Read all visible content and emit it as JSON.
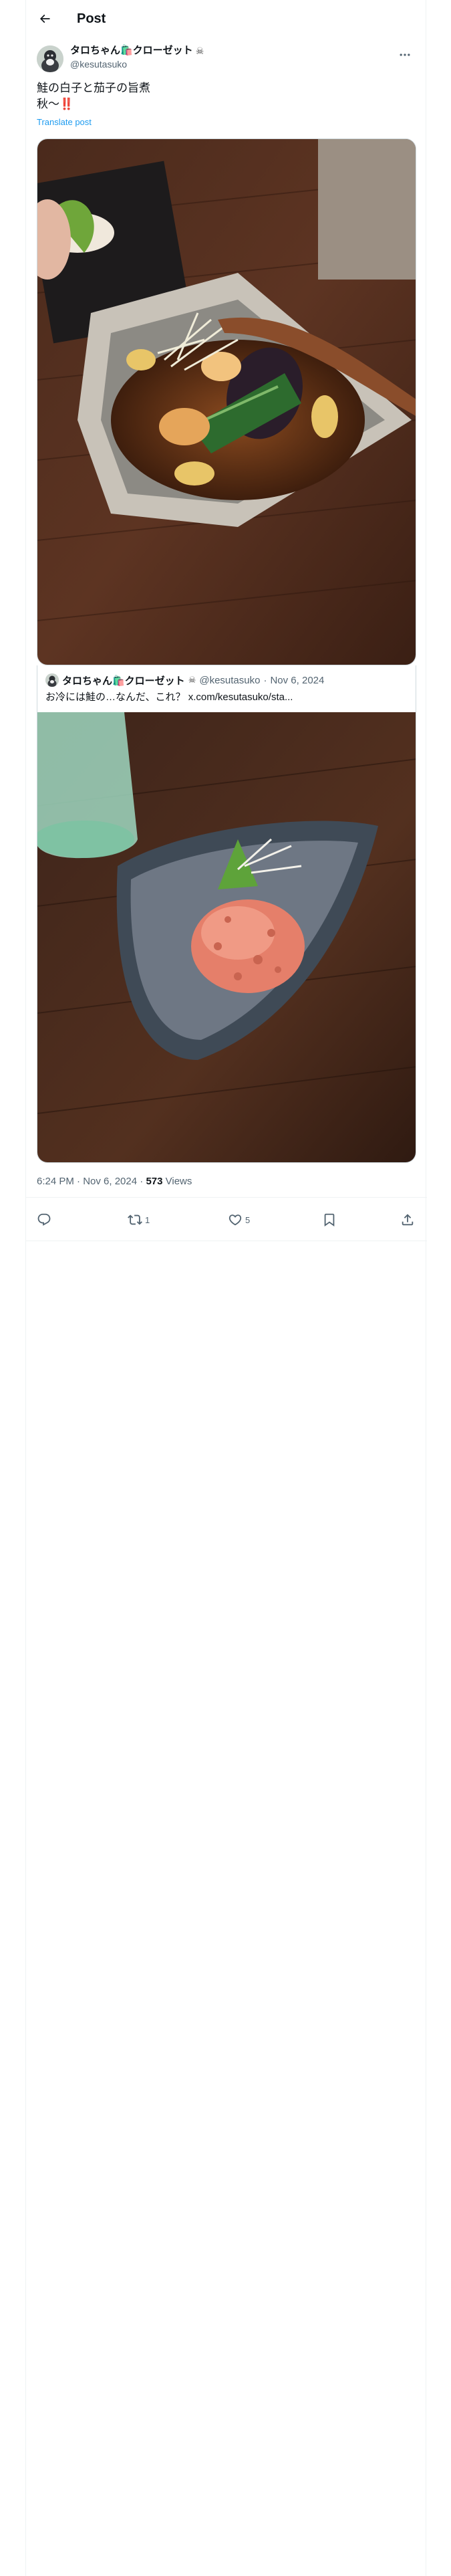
{
  "header": {
    "title": "Post"
  },
  "author": {
    "display_name": "タロちゃん🛍️クローゼット",
    "badge_icon": "skull-crossbones-icon",
    "handle": "@kesutasuko"
  },
  "tweet": {
    "text": "鮭の白子と茄子の旨煮\n秋〜‼️",
    "translate_label": "Translate post"
  },
  "quote": {
    "display_name": "タロちゃん🛍️クローゼット",
    "handle": "@kesutasuko",
    "separator": "·",
    "date": "Nov 6, 2024",
    "text": "お冷には鮭の…なんだ、これ？ x.com/kesutasuko/sta..."
  },
  "meta": {
    "time": "6:24 PM · Nov 6, 2024",
    "separator": "·",
    "views_count": "573",
    "views_label": "Views"
  },
  "actions": {
    "reply_count": "",
    "repost_count": "1",
    "like_count": "5"
  },
  "colors": {
    "accent": "#1d9bf0",
    "text": "#0f1419",
    "secondary": "#536471",
    "border": "#cfd9de"
  }
}
